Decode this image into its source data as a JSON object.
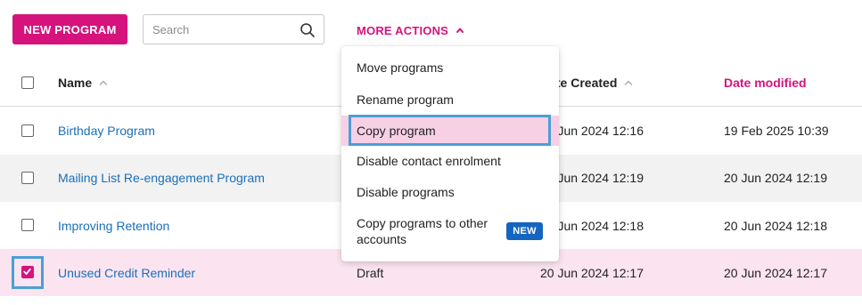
{
  "toolbar": {
    "new_program_label": "NEW PROGRAM",
    "search_placeholder": "Search",
    "more_actions_label": "MORE ACTIONS"
  },
  "table": {
    "columns": {
      "name": "Name",
      "date_created": "Date Created",
      "date_modified": "Date modified"
    },
    "rows": [
      {
        "name": "Birthday Program",
        "status": "",
        "created": "20 Jun 2024 12:16",
        "modified": "19 Feb 2025 10:39",
        "checked": false
      },
      {
        "name": "Mailing List Re-engagement Program",
        "status": "",
        "created": "20 Jun 2024 12:19",
        "modified": "20 Jun 2024 12:19",
        "checked": false
      },
      {
        "name": "Improving Retention",
        "status": "",
        "created": "20 Jun 2024 12:18",
        "modified": "20 Jun 2024 12:18",
        "checked": false
      },
      {
        "name": "Unused Credit Reminder",
        "status": "Draft",
        "created": "20 Jun 2024 12:17",
        "modified": "20 Jun 2024 12:17",
        "checked": true
      }
    ]
  },
  "dropdown": {
    "items": [
      {
        "label": "Move programs"
      },
      {
        "label": "Rename program"
      },
      {
        "label": "Copy program",
        "active": true
      },
      {
        "label": "Disable contact enrolment"
      },
      {
        "label": "Disable programs"
      },
      {
        "label": "Copy programs to other accounts",
        "badge": "NEW"
      }
    ]
  },
  "colors": {
    "accent": "#d6127d",
    "link": "#1a6fb8",
    "highlight": "#4a9fd6",
    "selected_row": "#fbe4f0",
    "badge": "#1565c0"
  },
  "icons": {
    "search": "search-icon",
    "more_actions": "chevron-up-icon",
    "sort": "sort-up-icon",
    "check": "check-icon"
  }
}
